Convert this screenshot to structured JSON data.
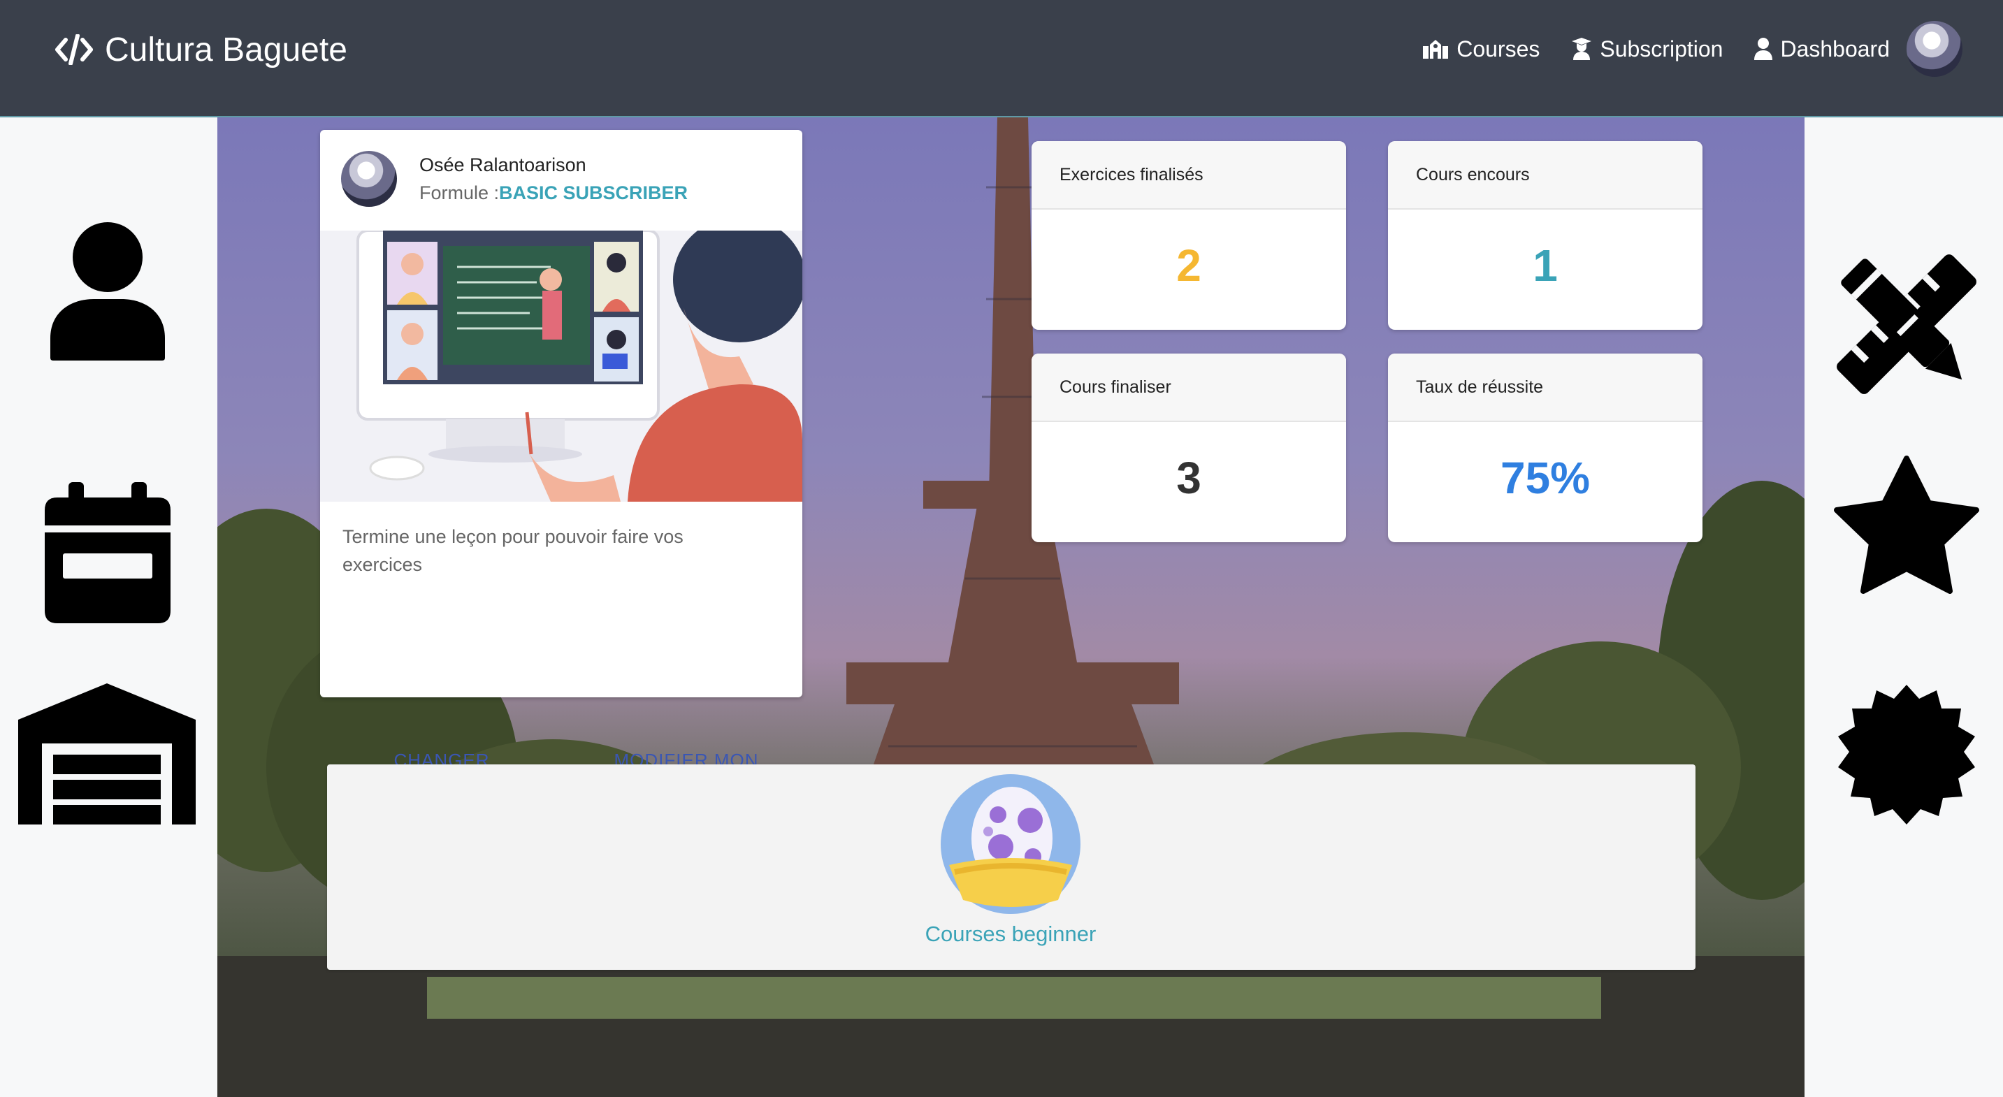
{
  "navbar": {
    "brand": "Cultura Baguete",
    "links": [
      {
        "label": "Courses",
        "icon": "school-icon"
      },
      {
        "label": "Subscription",
        "icon": "graduate-icon"
      },
      {
        "label": "Dashboard",
        "icon": "user-icon"
      }
    ]
  },
  "profile": {
    "name": "Osée Ralantoarison",
    "formula_prefix": "Formule :",
    "formula_value": "BASIC SUBSCRIBER",
    "message": "Termine une leçon pour pouvoir faire vos exercices",
    "actions": {
      "change_formula": "CHANGER DE FORMULE",
      "edit_profile": "MODIFIER MON PROFIL"
    }
  },
  "stats": {
    "exercises_done": {
      "label": "Exercices finalisés",
      "value": "2",
      "color": "#f5b731"
    },
    "courses_in_progress": {
      "label": "Cours encours",
      "value": "1",
      "color": "#3aa3b7"
    },
    "courses_done": {
      "label": "Cours finaliser",
      "value": "3",
      "color": "#333333"
    },
    "success_rate": {
      "label": "Taux de réussite",
      "value": "75%",
      "color": "#2f7fe0"
    }
  },
  "courses": {
    "items": [
      {
        "label": "Courses beginner",
        "icon": "egg-nest-icon"
      }
    ]
  },
  "side_icons": {
    "left": [
      "user-silhouette-icon",
      "calendar-icon",
      "warehouse-icon"
    ],
    "right": [
      "pencil-ruler-icon",
      "star-icon",
      "certificate-icon"
    ]
  }
}
